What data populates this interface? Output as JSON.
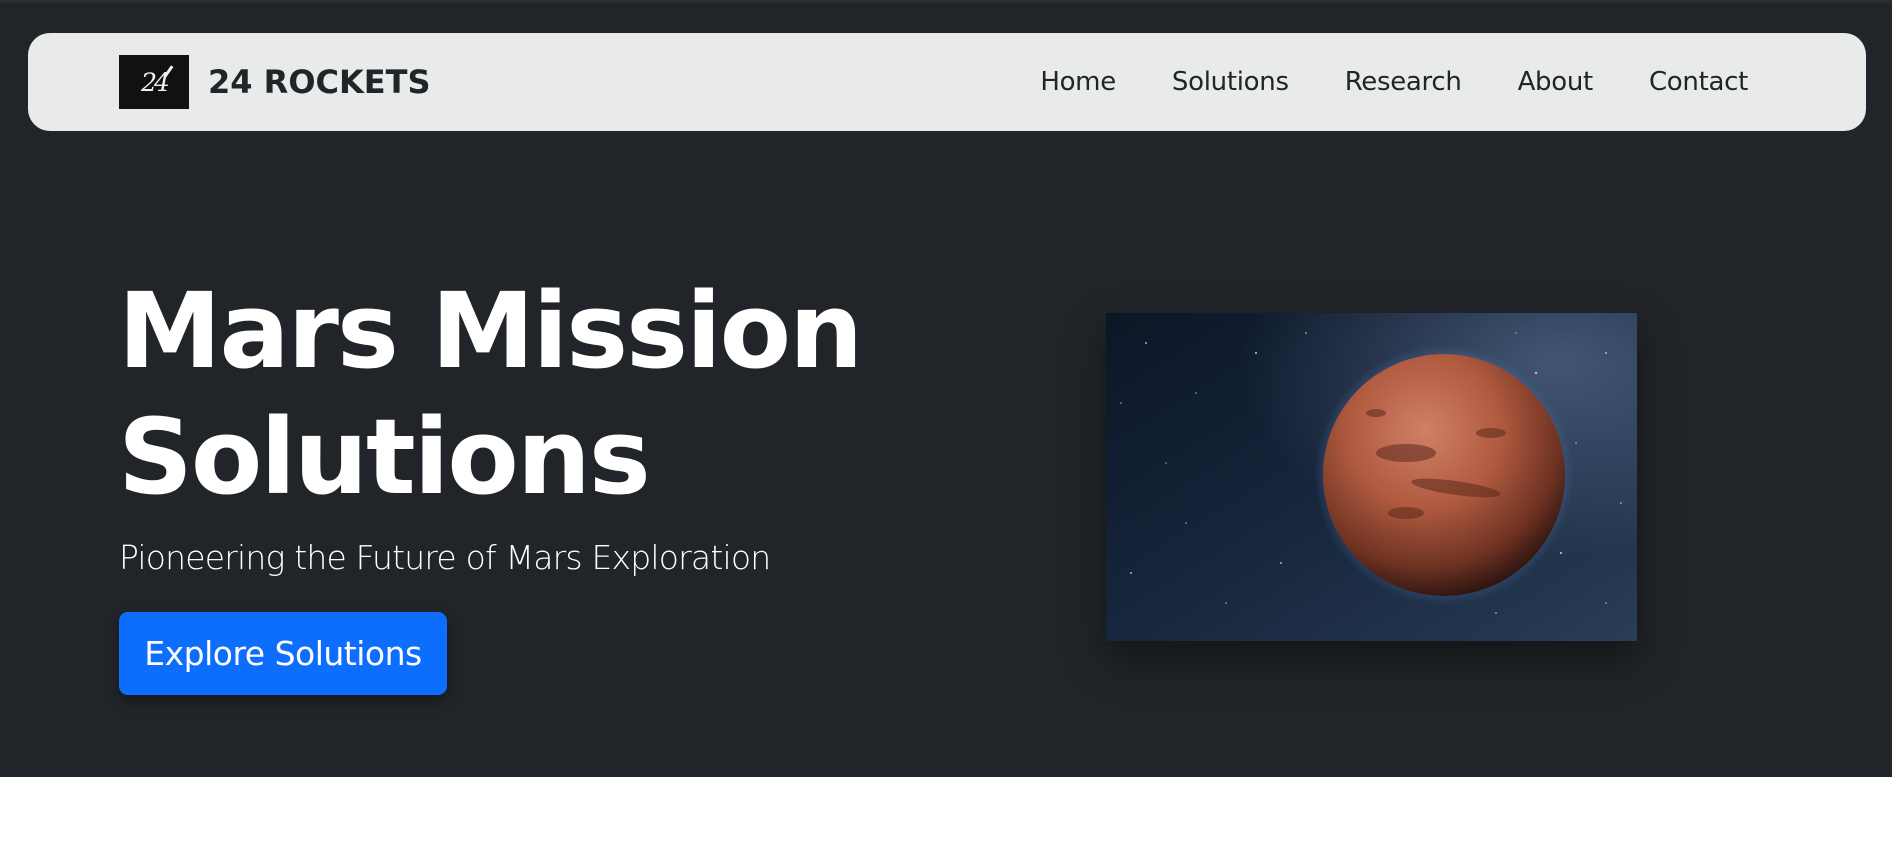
{
  "navbar": {
    "brand": {
      "logo_text": "24",
      "name": "24 ROCKETS"
    },
    "links": [
      {
        "label": "Home"
      },
      {
        "label": "Solutions"
      },
      {
        "label": "Research"
      },
      {
        "label": "About"
      },
      {
        "label": "Contact"
      }
    ]
  },
  "hero": {
    "title": "Mars Mission Solutions",
    "subtitle": "Pioneering the Future of Mars Exploration",
    "cta_label": "Explore Solutions",
    "image_icon": "mars-planet-image"
  },
  "colors": {
    "hero_background": "#212529",
    "navbar_background": "#e9eaea",
    "primary_button": "#0d6efd",
    "text_dark": "#212529",
    "text_light": "#ffffff"
  }
}
